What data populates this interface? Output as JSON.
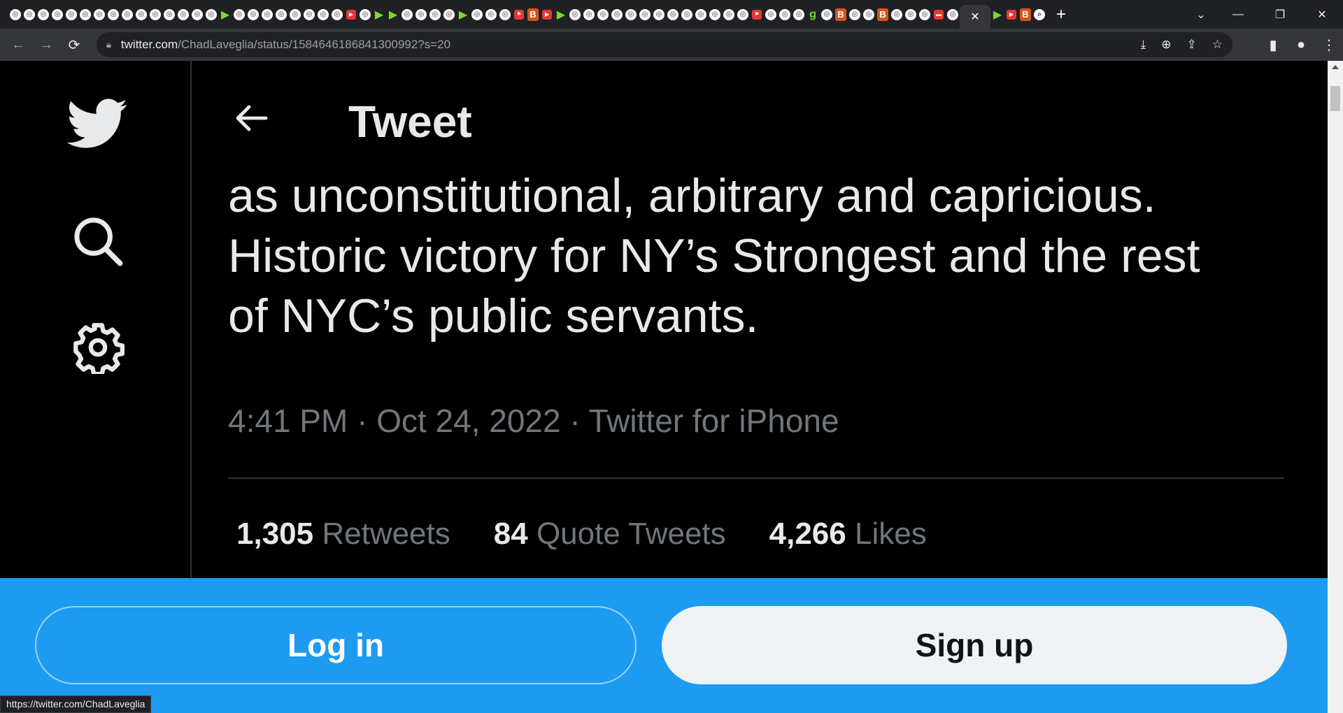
{
  "browser": {
    "url_host": "twitter.com",
    "url_path": "/ChadLaveglia/status/1584646186841300992?s=20",
    "status_url": "https://twitter.com/ChadLaveglia",
    "icons": {
      "lock": "lock-icon",
      "back": "arrow-left-icon",
      "forward": "arrow-right-icon",
      "reload": "reload-icon"
    }
  },
  "header": {
    "title": "Tweet"
  },
  "tweet": {
    "lines": [
      "as unconstitutional, arbitrary and capricious.",
      "Historic victory for NY’s Strongest and the rest",
      "of NYC’s public servants."
    ],
    "meta": "4:41 PM · Oct 24, 2022 · Twitter for iPhone"
  },
  "stats": {
    "retweets_count": "1,305",
    "retweets_label": "Retweets",
    "quotes_count": "84",
    "quotes_label": "Quote Tweets",
    "likes_count": "4,266",
    "likes_label": "Likes"
  },
  "cta": {
    "login_label": "Log in",
    "signup_label": "Sign up"
  },
  "colors": {
    "brand_blue": "#1d9bf0",
    "background": "#000000",
    "muted_text": "#71767b"
  }
}
